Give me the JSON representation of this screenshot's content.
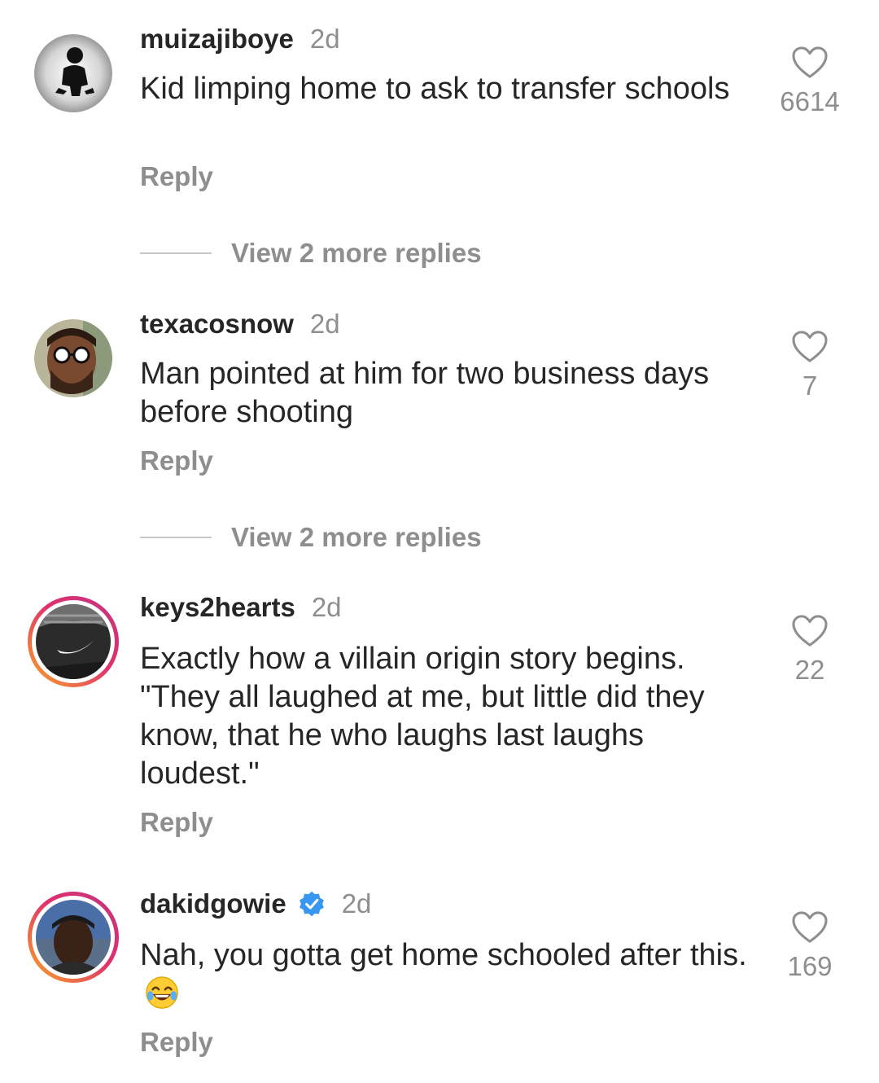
{
  "comments": [
    {
      "username": "muizajiboye",
      "time": "2d",
      "text": "Kid limping home to ask to transfer schools",
      "reply_label": "Reply",
      "likes": "6614",
      "view_more": "View 2 more replies"
    },
    {
      "username": "texacosnow",
      "time": "2d",
      "text": "Man pointed at him for two business days before shooting",
      "reply_label": "Reply",
      "likes": "7",
      "view_more": "View 2 more replies"
    },
    {
      "username": "keys2hearts",
      "time": "2d",
      "text": "Exactly how a villain origin story begins. \"They all laughed at me, but little did they know, that he who laughs last laughs loudest.\"",
      "reply_label": "Reply",
      "likes": "22"
    },
    {
      "username": "dakidgowie",
      "verified": true,
      "time": "2d",
      "text": "Nah, you gotta get home schooled after this.",
      "emoji": "face-with-tears-of-joy",
      "reply_label": "Reply",
      "likes": "169"
    }
  ],
  "colors": {
    "primary_text": "#262626",
    "secondary_text": "#8e8e8e",
    "verified_blue": "#3897f0"
  },
  "icons": [
    "heart-icon",
    "verified-badge-icon",
    "laughing-emoji-icon"
  ]
}
